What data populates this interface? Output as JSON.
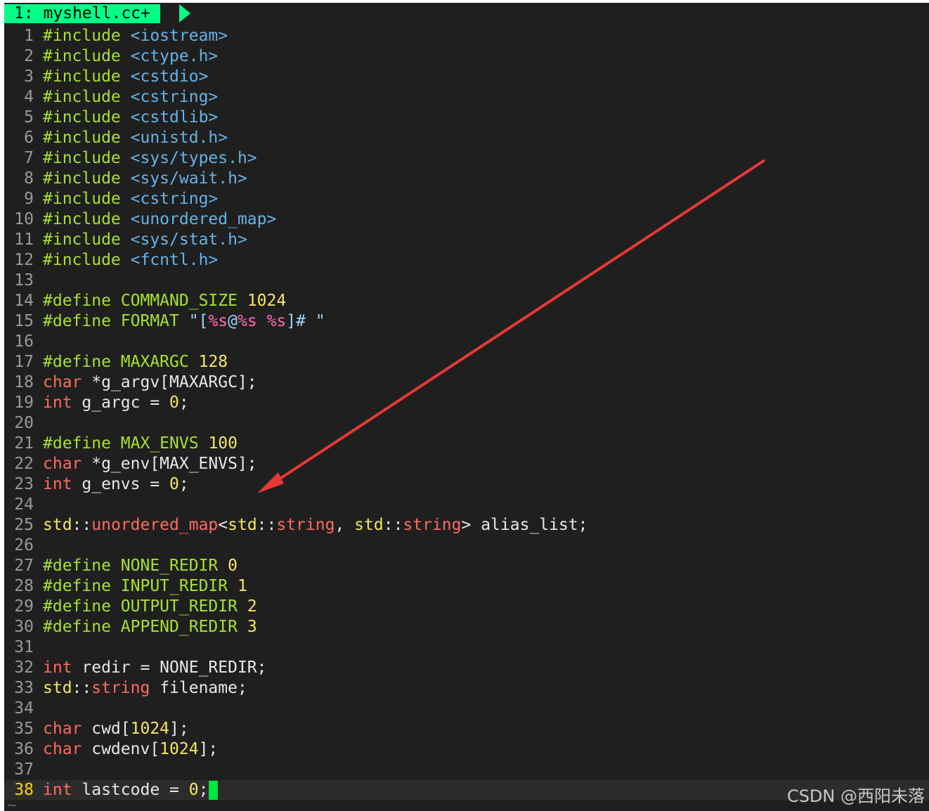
{
  "tab": {
    "label": "1: myshell.cc+"
  },
  "lines": [
    {
      "n": "1",
      "tokens": [
        [
          "pp",
          "#include"
        ],
        [
          "op",
          " "
        ],
        [
          "inc",
          "<iostream>"
        ]
      ]
    },
    {
      "n": "2",
      "tokens": [
        [
          "pp",
          "#include"
        ],
        [
          "op",
          " "
        ],
        [
          "inc",
          "<ctype.h>"
        ]
      ]
    },
    {
      "n": "3",
      "tokens": [
        [
          "pp",
          "#include"
        ],
        [
          "op",
          " "
        ],
        [
          "inc",
          "<cstdio>"
        ]
      ]
    },
    {
      "n": "4",
      "tokens": [
        [
          "pp",
          "#include"
        ],
        [
          "op",
          " "
        ],
        [
          "inc",
          "<cstring>"
        ]
      ]
    },
    {
      "n": "5",
      "tokens": [
        [
          "pp",
          "#include"
        ],
        [
          "op",
          " "
        ],
        [
          "inc",
          "<cstdlib>"
        ]
      ]
    },
    {
      "n": "6",
      "tokens": [
        [
          "pp",
          "#include"
        ],
        [
          "op",
          " "
        ],
        [
          "inc",
          "<unistd.h>"
        ]
      ]
    },
    {
      "n": "7",
      "tokens": [
        [
          "pp",
          "#include"
        ],
        [
          "op",
          " "
        ],
        [
          "inc",
          "<sys/types.h>"
        ]
      ]
    },
    {
      "n": "8",
      "tokens": [
        [
          "pp",
          "#include"
        ],
        [
          "op",
          " "
        ],
        [
          "inc",
          "<sys/wait.h>"
        ]
      ]
    },
    {
      "n": "9",
      "tokens": [
        [
          "pp",
          "#include"
        ],
        [
          "op",
          " "
        ],
        [
          "inc",
          "<cstring>"
        ]
      ]
    },
    {
      "n": "10",
      "tokens": [
        [
          "pp",
          "#include"
        ],
        [
          "op",
          " "
        ],
        [
          "inc",
          "<unordered_map>"
        ]
      ]
    },
    {
      "n": "11",
      "tokens": [
        [
          "pp",
          "#include"
        ],
        [
          "op",
          " "
        ],
        [
          "inc",
          "<sys/stat.h>"
        ]
      ]
    },
    {
      "n": "12",
      "tokens": [
        [
          "pp",
          "#include"
        ],
        [
          "op",
          " "
        ],
        [
          "inc",
          "<fcntl.h>"
        ]
      ]
    },
    {
      "n": "13",
      "tokens": []
    },
    {
      "n": "14",
      "tokens": [
        [
          "pp",
          "#define"
        ],
        [
          "op",
          " "
        ],
        [
          "ppname",
          "COMMAND_SIZE"
        ],
        [
          "op",
          " "
        ],
        [
          "num",
          "1024"
        ]
      ]
    },
    {
      "n": "15",
      "tokens": [
        [
          "pp",
          "#define"
        ],
        [
          "op",
          " "
        ],
        [
          "ppname",
          "FORMAT"
        ],
        [
          "op",
          " "
        ],
        [
          "str",
          "\"["
        ],
        [
          "fmt",
          "%s"
        ],
        [
          "str",
          "@"
        ],
        [
          "fmt",
          "%s"
        ],
        [
          "str",
          " "
        ],
        [
          "fmt",
          "%s"
        ],
        [
          "str",
          "]# \""
        ]
      ]
    },
    {
      "n": "16",
      "tokens": []
    },
    {
      "n": "17",
      "tokens": [
        [
          "pp",
          "#define"
        ],
        [
          "op",
          " "
        ],
        [
          "ppname",
          "MAXARGC"
        ],
        [
          "op",
          " "
        ],
        [
          "num",
          "128"
        ]
      ]
    },
    {
      "n": "18",
      "tokens": [
        [
          "kw",
          "char"
        ],
        [
          "id",
          " *g_argv[MAXARGC];"
        ]
      ]
    },
    {
      "n": "19",
      "tokens": [
        [
          "kw",
          "int"
        ],
        [
          "id",
          " g_argc = "
        ],
        [
          "num",
          "0"
        ],
        [
          "id",
          ";"
        ]
      ]
    },
    {
      "n": "20",
      "tokens": []
    },
    {
      "n": "21",
      "tokens": [
        [
          "pp",
          "#define"
        ],
        [
          "op",
          " "
        ],
        [
          "ppname",
          "MAX_ENVS"
        ],
        [
          "op",
          " "
        ],
        [
          "num",
          "100"
        ]
      ]
    },
    {
      "n": "22",
      "tokens": [
        [
          "kw",
          "char"
        ],
        [
          "id",
          " *g_env[MAX_ENVS];"
        ]
      ]
    },
    {
      "n": "23",
      "tokens": [
        [
          "kw",
          "int"
        ],
        [
          "id",
          " g_envs = "
        ],
        [
          "num",
          "0"
        ],
        [
          "id",
          ";"
        ]
      ]
    },
    {
      "n": "24",
      "tokens": []
    },
    {
      "n": "25",
      "tokens": [
        [
          "ns",
          "std"
        ],
        [
          "id",
          "::"
        ],
        [
          "kw",
          "unordered_map"
        ],
        [
          "id",
          "<"
        ],
        [
          "ns",
          "std"
        ],
        [
          "id",
          "::"
        ],
        [
          "kw",
          "string"
        ],
        [
          "id",
          ", "
        ],
        [
          "ns",
          "std"
        ],
        [
          "id",
          "::"
        ],
        [
          "kw",
          "string"
        ],
        [
          "id",
          "> alias_list;"
        ]
      ]
    },
    {
      "n": "26",
      "tokens": []
    },
    {
      "n": "27",
      "tokens": [
        [
          "pp",
          "#define"
        ],
        [
          "op",
          " "
        ],
        [
          "ppname",
          "NONE_REDIR"
        ],
        [
          "op",
          " "
        ],
        [
          "num",
          "0"
        ]
      ]
    },
    {
      "n": "28",
      "tokens": [
        [
          "pp",
          "#define"
        ],
        [
          "op",
          " "
        ],
        [
          "ppname",
          "INPUT_REDIR"
        ],
        [
          "op",
          " "
        ],
        [
          "num",
          "1"
        ]
      ]
    },
    {
      "n": "29",
      "tokens": [
        [
          "pp",
          "#define"
        ],
        [
          "op",
          " "
        ],
        [
          "ppname",
          "OUTPUT_REDIR"
        ],
        [
          "op",
          " "
        ],
        [
          "num",
          "2"
        ]
      ]
    },
    {
      "n": "30",
      "tokens": [
        [
          "pp",
          "#define"
        ],
        [
          "op",
          " "
        ],
        [
          "ppname",
          "APPEND_REDIR"
        ],
        [
          "op",
          " "
        ],
        [
          "num",
          "3"
        ]
      ]
    },
    {
      "n": "31",
      "tokens": []
    },
    {
      "n": "32",
      "tokens": [
        [
          "kw",
          "int"
        ],
        [
          "id",
          " redir = NONE_REDIR;"
        ]
      ]
    },
    {
      "n": "33",
      "tokens": [
        [
          "ns",
          "std"
        ],
        [
          "id",
          "::"
        ],
        [
          "kw",
          "string"
        ],
        [
          "id",
          " filename;"
        ]
      ]
    },
    {
      "n": "34",
      "tokens": []
    },
    {
      "n": "35",
      "tokens": [
        [
          "kw",
          "char"
        ],
        [
          "id",
          " cwd["
        ],
        [
          "num",
          "1024"
        ],
        [
          "id",
          "];"
        ]
      ]
    },
    {
      "n": "36",
      "tokens": [
        [
          "kw",
          "char"
        ],
        [
          "id",
          " cwdenv["
        ],
        [
          "num",
          "1024"
        ],
        [
          "id",
          "];"
        ]
      ]
    },
    {
      "n": "37",
      "tokens": []
    },
    {
      "n": "38",
      "tokens": [
        [
          "kw",
          "int"
        ],
        [
          "id",
          " lastcode = "
        ],
        [
          "num",
          "0"
        ],
        [
          "id",
          ";"
        ]
      ],
      "current": true
    }
  ],
  "tilde": "~",
  "watermark": "CSDN @西阳未落",
  "colors": {
    "background": "#1f1f1f",
    "tab": "#00ff87",
    "cursor": "#00e640",
    "arrow": "#e53935"
  }
}
